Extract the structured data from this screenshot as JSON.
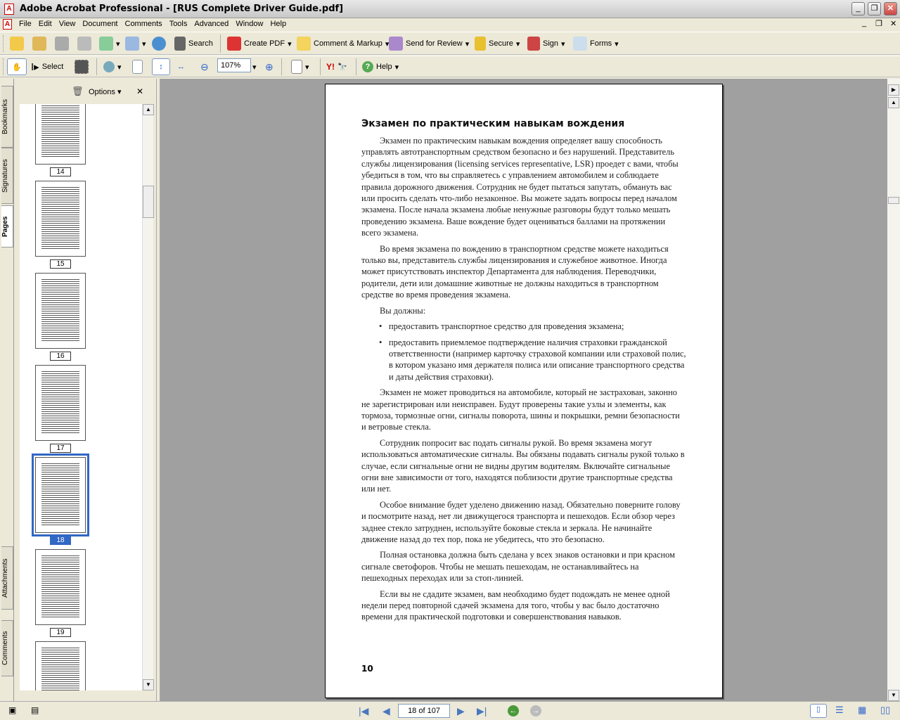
{
  "window": {
    "title": "Adobe Acrobat Professional - [RUS Complete Driver Guide.pdf]"
  },
  "menu": [
    "File",
    "Edit",
    "View",
    "Document",
    "Comments",
    "Tools",
    "Advanced",
    "Window",
    "Help"
  ],
  "toolbar1": {
    "search": "Search",
    "create_pdf": "Create PDF",
    "comment_markup": "Comment & Markup",
    "send_review": "Send for Review",
    "secure": "Secure",
    "sign": "Sign",
    "forms": "Forms"
  },
  "toolbar2": {
    "select": "Select",
    "zoom": "107%",
    "help": "Help"
  },
  "side_tabs": [
    "Bookmarks",
    "Signatures",
    "Pages",
    "Attachments",
    "Comments"
  ],
  "nav": {
    "options": "Options",
    "close": "✕",
    "thumbs": [
      "14",
      "15",
      "16",
      "17",
      "18",
      "19"
    ],
    "selected": "18"
  },
  "document": {
    "heading": "Экзамен по практическим навыкам вождения",
    "paragraphs": [
      "Экзамен по практическим навыкам вождения определяет вашу способность управлять автотранспортным средством безопасно и без нарушений. Представитель службы лицензирования (licensing services representative, LSR) проедет с вами, чтобы убедиться в том, что вы справляетесь с управлением автомобилем и соблюдаете правила дорожного движения. Сотрудник не будет пытаться запутать, обмануть вас или просить сделать что-либо незаконное. Вы можете задать вопросы перед началом экзамена. После начала экзамена любые ненужные разговоры будут только мешать проведению экзамена. Ваше вождение будет оцениваться баллами на протяжении всего экзамена.",
      "Во время экзамена по вождению в транспортном средстве можете находиться только вы, представитель службы лицензирования и служебное животное. Иногда может присутствовать инспектор Департамента для наблюдения. Переводчики, родители, дети или домашние животные не должны находиться в транспортном средстве во время проведения экзамена.",
      "Вы должны:"
    ],
    "bullets": [
      "предоставить транспортное средство для проведения экзамена;",
      "предоставить приемлемое подтверждение наличия страховки гражданской ответственности (например карточку страховой компании или страховой полис, в котором указано имя держателя полиса или описание транспортного средства и даты действия страховки)."
    ],
    "paragraphs2": [
      "Экзамен не может проводиться на автомобиле, который не застрахован, законно не зарегистрирован или неисправен. Будут проверены такие узлы и элементы, как тормоза, тормозные огни, сигналы поворота, шины и покрышки, ремни безопасности и ветровые стекла.",
      "Сотрудник попросит вас подать сигналы рукой. Во время экзамена могут использоваться автоматические сигналы. Вы обязаны подавать сигналы рукой только в случае, если сигнальные огни не видны другим водителям. Включайте сигнальные огни вне зависимости от того, находятся поблизости другие транспортные средства или нет.",
      "Особое внимание будет уделено движению назад. Обязательно поверните голову и посмотрите назад, нет ли движущегося транспорта и пешеходов. Если обзор через заднее стекло затруднен, используйте боковые стекла и зеркала. Не начинайте движение назад до тех пор, пока не убедитесь, что это безопасно.",
      "Полная остановка должна быть сделана у всех знаков остановки и при красном сигнале светофоров. Чтобы не мешать пешеходам, не останавливайтесь на пешеходных переходах или за стоп-линией.",
      "Если вы не сдадите экзамен, вам необходимо будет подождать не менее одной недели перед повторной сдачей экзамена для того, чтобы у вас было достаточно времени для практической подготовки и совершенствования навыков."
    ],
    "page_number": "10"
  },
  "statusbar": {
    "page": "18 of 107"
  }
}
